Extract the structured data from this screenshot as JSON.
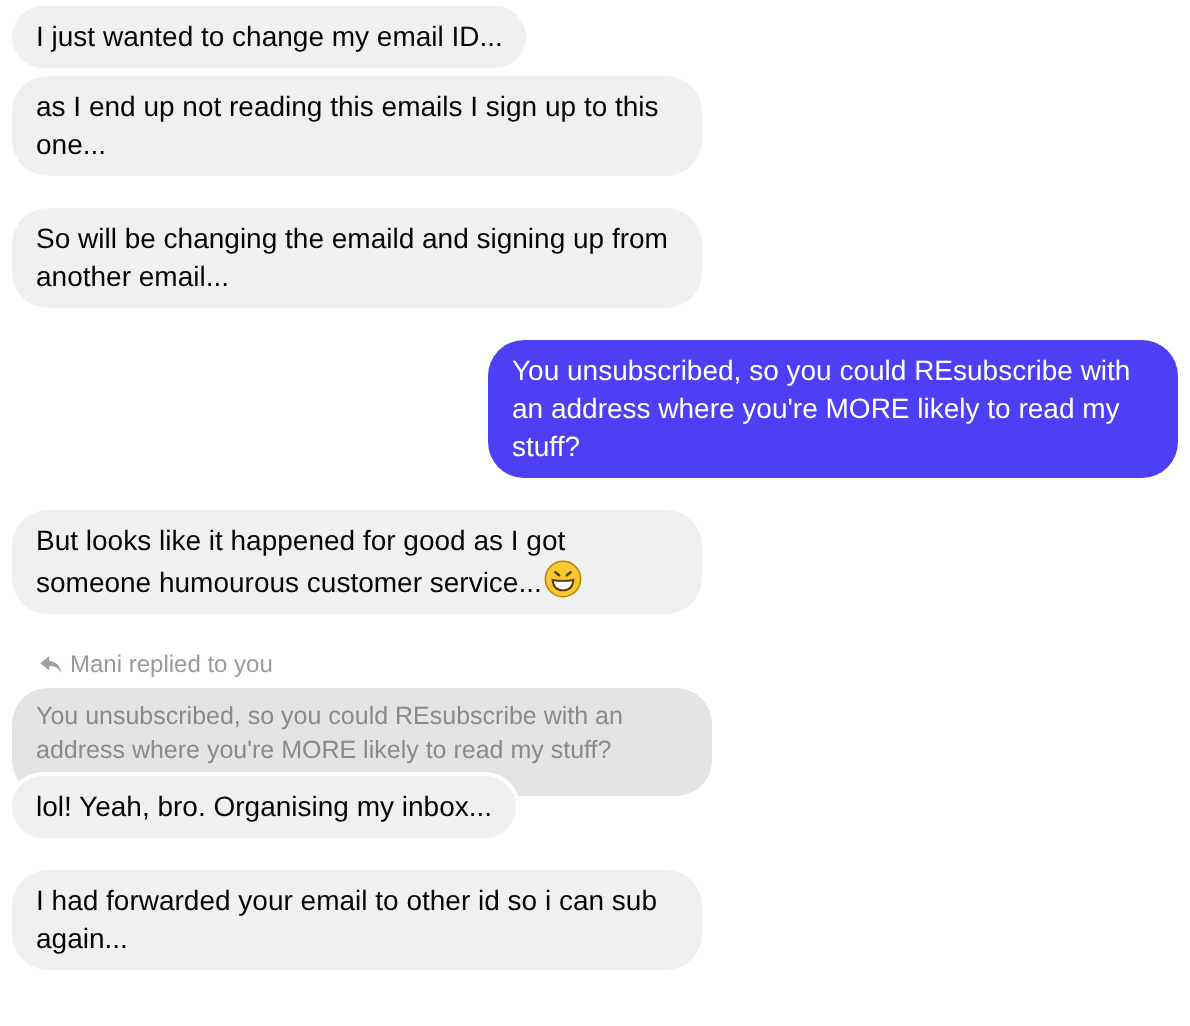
{
  "groups": [
    {
      "messages": [
        {
          "kind": "incoming",
          "text": "I just wanted to change my email ID...",
          "emoji": false
        },
        {
          "kind": "incoming",
          "text": "as I end up not reading this emails I sign up to this one...",
          "emoji": false
        }
      ]
    },
    {
      "messages": [
        {
          "kind": "incoming",
          "text": "So will be changing the emaild and signing up from another email...",
          "emoji": false
        }
      ]
    },
    {
      "messages": [
        {
          "kind": "outgoing",
          "text": "You unsubscribed, so you could REsubscribe with an address where you're MORE likely to read my stuff?",
          "emoji": false
        }
      ]
    },
    {
      "messages": [
        {
          "kind": "incoming",
          "text": "But looks like it happened for good as I got someone humourous customer service...",
          "emoji": true
        }
      ]
    },
    {
      "messages": [
        {
          "kind": "reply",
          "label": "Mani replied to you",
          "quote": "You unsubscribed, so you could REsubscribe with an address where you're MORE likely to read my stuff?",
          "text": "lol! Yeah, bro. Organising my inbox...",
          "emoji": false
        }
      ]
    },
    {
      "messages": [
        {
          "kind": "incoming",
          "text": "I had forwarded your email to other id so i can sub again...",
          "emoji": false
        }
      ]
    }
  ]
}
